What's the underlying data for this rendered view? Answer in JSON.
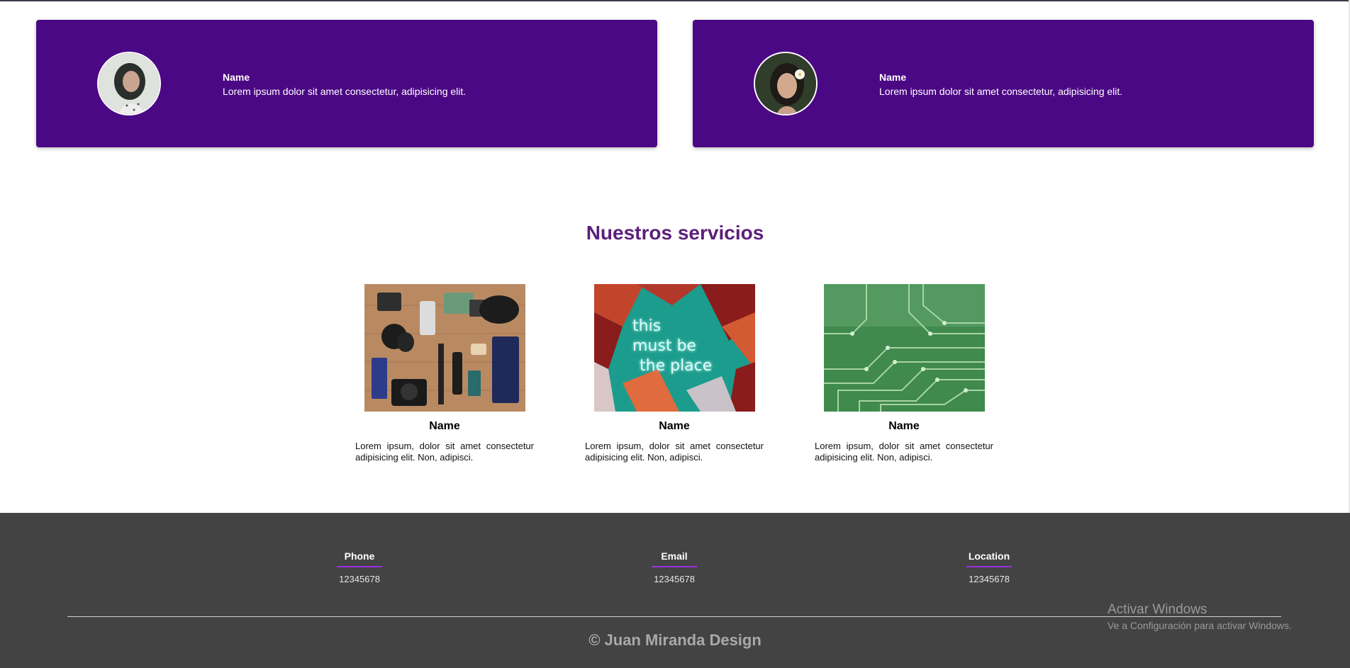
{
  "testimonials": [
    {
      "name": "Name",
      "quote": "Lorem ipsum dolor sit amet consectetur, adipisicing elit."
    },
    {
      "name": "Name",
      "quote": "Lorem ipsum dolor sit amet consectetur, adipisicing elit."
    }
  ],
  "services": {
    "title": "Nuestros servicios",
    "items": [
      {
        "name": "Name",
        "description": "Lorem ipsum, dolor sit amet consectetur adipisicing elit. Non, adipisci."
      },
      {
        "name": "Name",
        "description": "Lorem ipsum, dolor sit amet consectetur adipisicing elit. Non, adipisci.",
        "image_text": [
          "this",
          "must be",
          "the place"
        ]
      },
      {
        "name": "Name",
        "description": "Lorem ipsum, dolor sit amet consectetur adipisicing elit. Non, adipisci."
      }
    ]
  },
  "footer": {
    "contacts": [
      {
        "label": "Phone",
        "value": "12345678"
      },
      {
        "label": "Email",
        "value": "12345678"
      },
      {
        "label": "Location",
        "value": "12345678"
      }
    ],
    "copyright": "© Juan Miranda Design"
  },
  "watermark": {
    "title": "Activar Windows",
    "subtitle": "Ve a Configuración para activar Windows."
  },
  "colors": {
    "card_background": "#4b0884",
    "title": "#5b1f7a",
    "footer_background": "#434343",
    "accent_underline": "#9b30d9"
  }
}
